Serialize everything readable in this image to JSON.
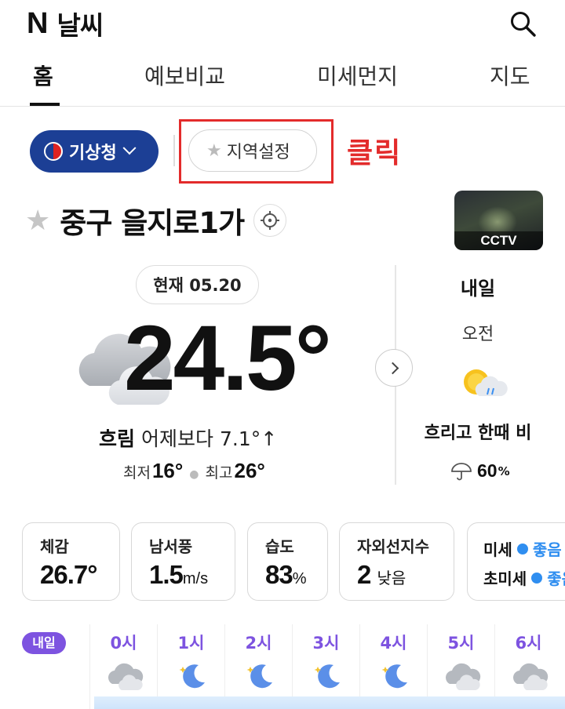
{
  "header": {
    "brand_logo": "N",
    "title": "날씨",
    "search_icon": "search-icon"
  },
  "tabs": [
    {
      "label": "홈",
      "active": true
    },
    {
      "label": "예보비교",
      "active": false
    },
    {
      "label": "미세먼지",
      "active": false
    },
    {
      "label": "지도",
      "active": false
    }
  ],
  "source": {
    "label": "기상청",
    "icon": "korea-emblem-icon"
  },
  "region_setting": {
    "label": "지역설정",
    "icon": "star-icon"
  },
  "annotation": {
    "text": "클릭",
    "color": "#e32b2b"
  },
  "location": {
    "name": "중구 을지로1가",
    "favorite_icon": "star-icon",
    "locate_icon": "crosshair-icon"
  },
  "cctv": {
    "label": "CCTV"
  },
  "current": {
    "now_label": "현재 05.20",
    "temperature": "24.5°",
    "condition": "흐림",
    "diff": "어제보다 7.1°↑",
    "min_label": "최저",
    "min_value": "16°",
    "max_label": "최고",
    "max_value": "26°",
    "icon": "cloudy-icon"
  },
  "tomorrow": {
    "title": "내일",
    "period": "오전",
    "condition": "흐리고 한때 비",
    "rain_chance": "60",
    "rain_unit": "%",
    "icon": "partly-cloudy-rain-icon",
    "umbrella_icon": "umbrella-icon"
  },
  "cards": {
    "feel": {
      "label": "체감",
      "value": "26.7°"
    },
    "wind": {
      "label": "남서풍",
      "value": "1.5",
      "unit": "m/s"
    },
    "humidity": {
      "label": "습도",
      "value": "83",
      "unit": "%"
    },
    "uv": {
      "label": "자외선지수",
      "value": "2",
      "unit": "낮음"
    },
    "dust": {
      "pm10_label": "미세",
      "pm10_status": "좋음",
      "pm25_label": "초미세",
      "pm25_status": "좋음"
    }
  },
  "hourly": {
    "badge": "내일",
    "hours": [
      {
        "label": "0시",
        "icon": "cloudy-icon"
      },
      {
        "label": "1시",
        "icon": "moon-icon"
      },
      {
        "label": "2시",
        "icon": "moon-icon"
      },
      {
        "label": "3시",
        "icon": "moon-icon"
      },
      {
        "label": "4시",
        "icon": "moon-icon"
      },
      {
        "label": "5시",
        "icon": "cloudy-icon"
      },
      {
        "label": "6시",
        "icon": "cloudy-icon"
      }
    ]
  },
  "colors": {
    "brand_blue": "#1c3f95",
    "hour_purple": "#7d53e0",
    "good_blue": "#2f8ef0",
    "annotation_red": "#e32b2b"
  }
}
